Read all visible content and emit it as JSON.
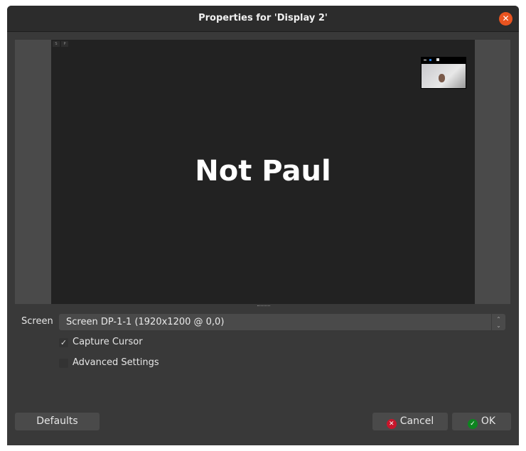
{
  "window": {
    "title": "Properties for 'Display 2'",
    "close_icon": "close-icon"
  },
  "preview": {
    "text": "Not Paul",
    "mini_buttons": [
      "S",
      "P"
    ]
  },
  "form": {
    "screen_label": "Screen",
    "screen_value": "Screen DP-1-1 (1920x1200 @ 0,0)",
    "capture_cursor": {
      "label": "Capture Cursor",
      "checked": true,
      "mark": "✓"
    },
    "advanced_settings": {
      "label": "Advanced Settings",
      "checked": false
    }
  },
  "buttons": {
    "defaults": "Defaults",
    "cancel": "Cancel",
    "ok": "OK"
  },
  "colors": {
    "accent_close": "#e95420",
    "cancel_icon": "#c7162b",
    "ok_icon": "#0e8420"
  }
}
